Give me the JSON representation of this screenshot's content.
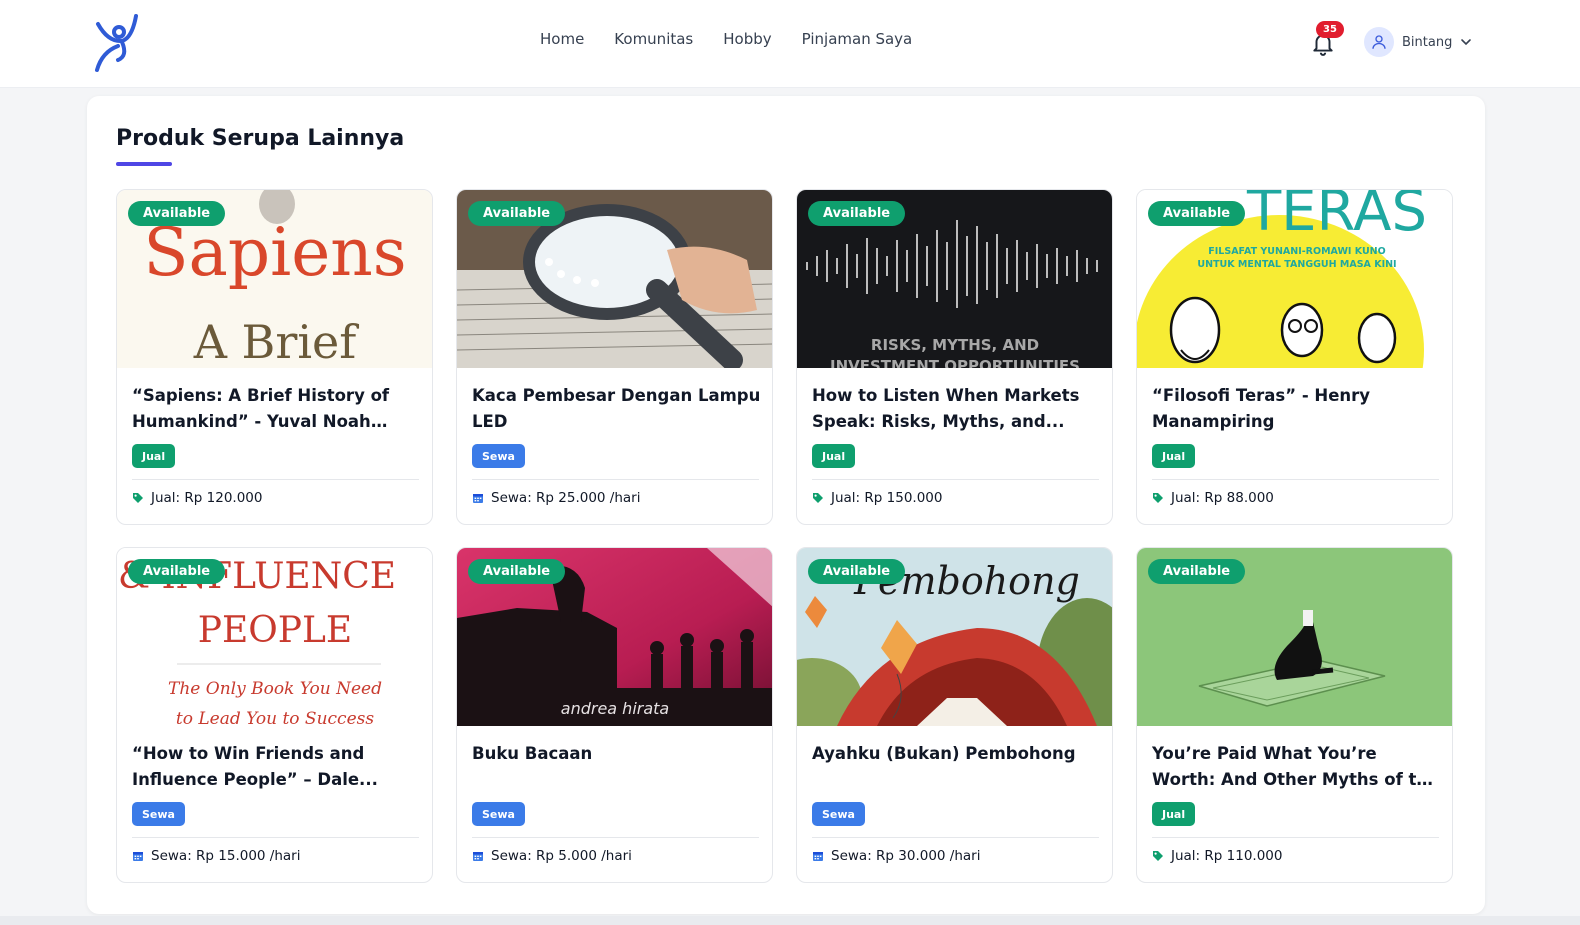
{
  "nav": {
    "links": [
      "Home",
      "Komunitas",
      "Hobby",
      "Pinjaman Saya"
    ],
    "notification_count": "35",
    "user_name": "Bintang"
  },
  "section": {
    "title": "Produk Serupa Lainnya"
  },
  "products": [
    {
      "status": "Available",
      "title": "“Sapiens: A Brief History of Humankind” - Yuval Noah Harari",
      "type": "Jual",
      "price": "Jual: Rp 120.000",
      "image_text": [
        "Sapiens",
        "A Brief"
      ]
    },
    {
      "status": "Available",
      "title": "Kaca Pembesar Dengan Lampu LED",
      "type": "Sewa",
      "price": "Sewa: Rp 25.000 /hari",
      "image_text": []
    },
    {
      "status": "Available",
      "title": "How to Listen When Markets Speak: Risks, Myths, and...",
      "type": "Jual",
      "price": "Jual: Rp 150.000",
      "image_text": [
        "RISKS, MYTHS, AND",
        "INVESTMENT OPPORTUNITIES"
      ]
    },
    {
      "status": "Available",
      "title": "“Filosofi Teras” - Henry Manampiring",
      "type": "Jual",
      "price": "Jual: Rp 88.000",
      "image_text": [
        "TERAS",
        "FILSAFAT YUNANI-ROMAWI KUNO",
        "UNTUK MENTAL TANGGUH MASA KINI"
      ]
    },
    {
      "status": "Available",
      "title": "“How to Win Friends and Influence People” – Dale...",
      "type": "Sewa",
      "price": "Sewa: Rp 15.000 /hari",
      "image_text": [
        "& INFLUENCE",
        "PEOPLE",
        "The Only Book You Need",
        "to Lead You to Success"
      ]
    },
    {
      "status": "Available",
      "title": "Buku Bacaan",
      "type": "Sewa",
      "price": "Sewa: Rp 5.000 /hari",
      "image_text": [
        "andrea hirata"
      ]
    },
    {
      "status": "Available",
      "title": "Ayahku (Bukan) Pembohong",
      "type": "Sewa",
      "price": "Sewa: Rp 30.000 /hari",
      "image_text": [
        "Pembohong"
      ]
    },
    {
      "status": "Available",
      "title": "You’re Paid What You’re Worth: And Other Myths of the Modern...",
      "type": "Jual",
      "price": "Jual: Rp 110.000",
      "image_text": []
    }
  ],
  "colors": {
    "accent": "#4f46e5",
    "available": "#0f9f6e",
    "jual": "#0f9f6e",
    "sewa": "#3b7be8",
    "notification": "#e11d2e",
    "logo": "#2f5bd6"
  },
  "icons": {
    "jual": "tag-icon",
    "sewa": "calendar-icon",
    "notification": "bell-icon",
    "user": "user-icon",
    "dropdown": "chevron-down-icon"
  }
}
